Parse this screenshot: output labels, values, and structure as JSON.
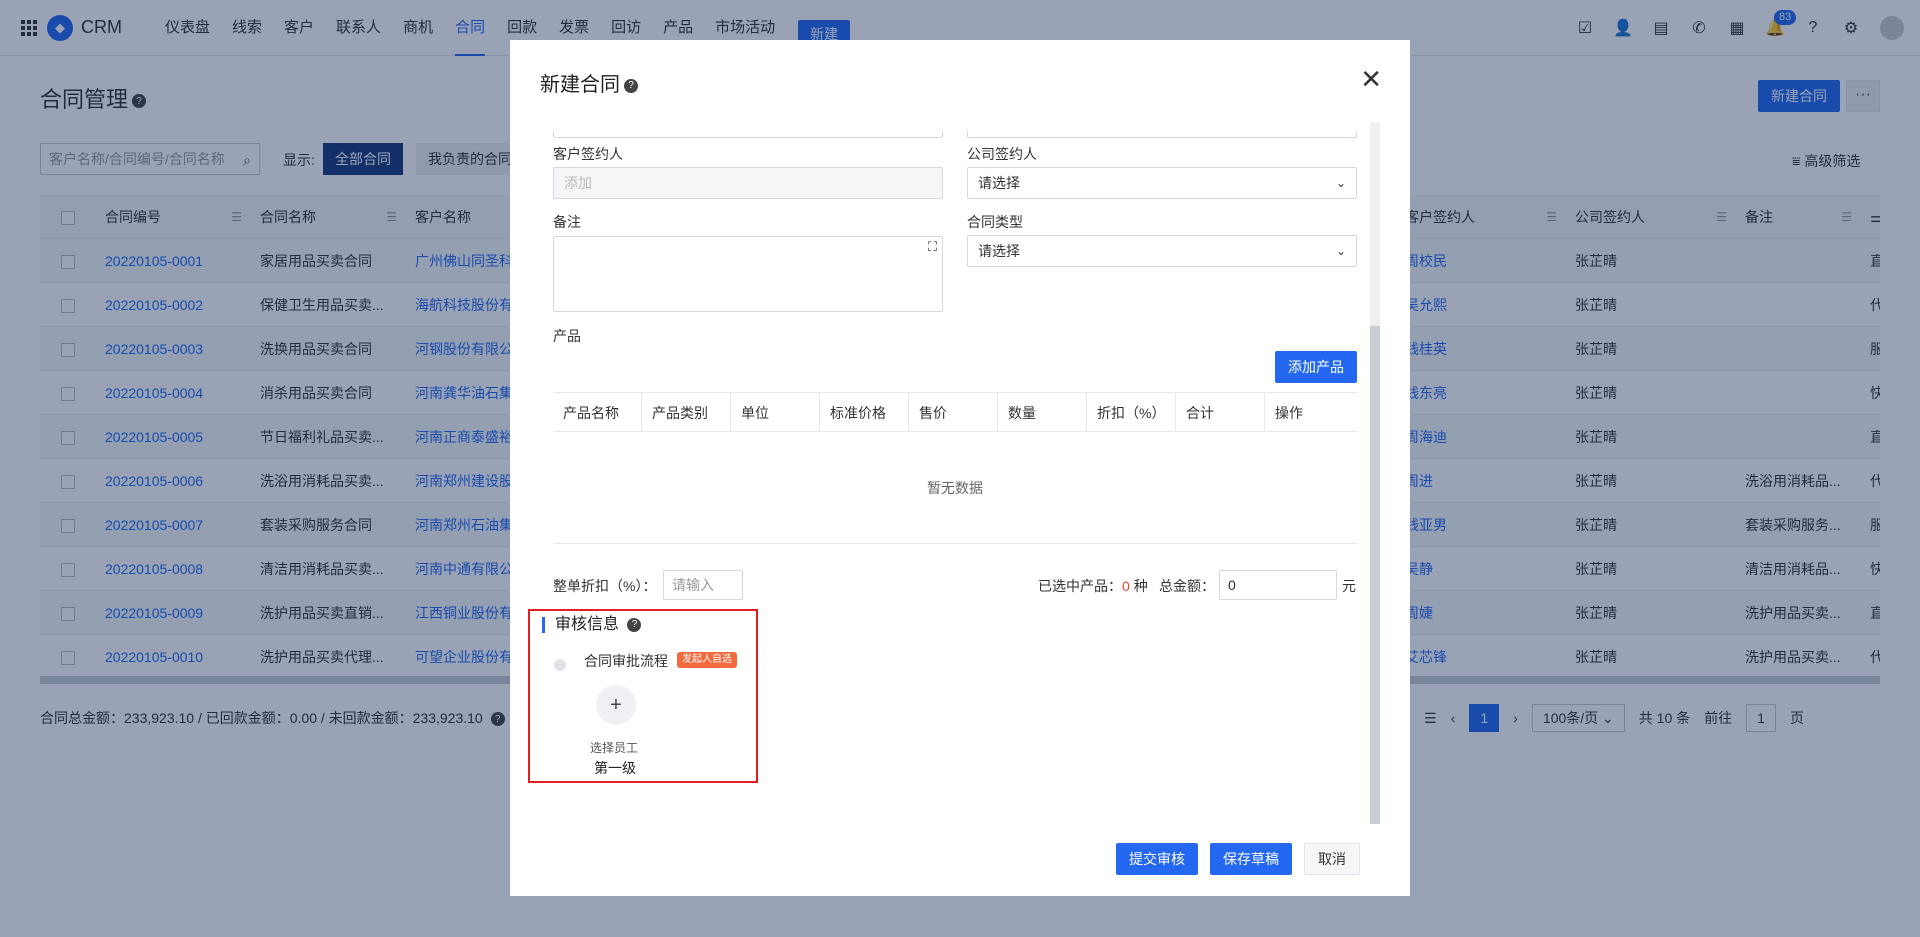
{
  "nav": {
    "brand": "CRM",
    "items": [
      "仪表盘",
      "线索",
      "客户",
      "联系人",
      "商机",
      "合同",
      "回款",
      "发票",
      "回访",
      "产品",
      "市场活动"
    ],
    "active_index": 5,
    "new_label": "新建",
    "notification_count": "83",
    "icons": [
      "task-icon",
      "contact-icon",
      "note-icon",
      "phone-icon",
      "calendar-icon",
      "bell-icon",
      "help-icon",
      "settings-icon"
    ]
  },
  "page": {
    "title": "合同管理",
    "new_button": "新建合同",
    "more_button": "···",
    "search_placeholder": "客户名称/合同编号/合同名称",
    "show_label": "显示:",
    "filter_all": "全部合同",
    "filter_mine": "我负责的合同",
    "advanced_filter": "高级筛选"
  },
  "table": {
    "headers": [
      "合同编号",
      "合同名称",
      "客户名称",
      "客户签约人",
      "公司签约人",
      "备注"
    ],
    "rows": [
      {
        "no": "20220105-0001",
        "name": "家居用品买卖合同",
        "customer": "广州佛山同圣科",
        "signer": "周校民",
        "company_signer": "张芷晴",
        "remark": "",
        "extra": "直"
      },
      {
        "no": "20220105-0002",
        "name": "保健卫生用品买卖...",
        "customer": "海航科技股份有",
        "signer": "吴允熙",
        "company_signer": "张芷晴",
        "remark": "",
        "extra": "代"
      },
      {
        "no": "20220105-0003",
        "name": "洗换用品买卖合同",
        "customer": "河钢股份有限公",
        "signer": "钱桂英",
        "company_signer": "张芷晴",
        "remark": "",
        "extra": "服"
      },
      {
        "no": "20220105-0004",
        "name": "消杀用品买卖合同",
        "customer": "河南龚华油石集",
        "signer": "钱东亮",
        "company_signer": "张芷晴",
        "remark": "",
        "extra": "快"
      },
      {
        "no": "20220105-0005",
        "name": "节日福利礼品买卖...",
        "customer": "河南正商泰盛裕",
        "signer": "周海迪",
        "company_signer": "张芷晴",
        "remark": "",
        "extra": "直"
      },
      {
        "no": "20220105-0006",
        "name": "洗浴用消耗品买卖...",
        "customer": "河南郑州建设股",
        "signer": "周进",
        "company_signer": "张芷晴",
        "remark": "洗浴用消耗品...",
        "extra": "代"
      },
      {
        "no": "20220105-0007",
        "name": "套装采购服务合同",
        "customer": "河南郑州石油集",
        "signer": "钱亚男",
        "company_signer": "张芷晴",
        "remark": "套装采购服务...",
        "extra": "服"
      },
      {
        "no": "20220105-0008",
        "name": "清洁用消耗品买卖...",
        "customer": "河南中通有限公",
        "signer": "吴静",
        "company_signer": "张芷晴",
        "remark": "清洁用消耗品...",
        "extra": "快"
      },
      {
        "no": "20220105-0009",
        "name": "洗护用品买卖直销...",
        "customer": "江西铜业股份有",
        "signer": "周婕",
        "company_signer": "张芷晴",
        "remark": "洗护用品买卖...",
        "extra": "直"
      },
      {
        "no": "20220105-0010",
        "name": "洗护用品买卖代理...",
        "customer": "可望企业股份有",
        "signer": "艾芯锋",
        "company_signer": "张芷晴",
        "remark": "洗护用品买卖...",
        "extra": "代"
      }
    ],
    "footer_summary": "合同总金额：233,923.10 / 已回款金额：0.00 / 未回款金额：233,923.10",
    "pager": {
      "current": "1",
      "page_size": "100条/页",
      "total": "共 10 条",
      "goto_label": "前往",
      "goto_value": "1",
      "page_unit": "页"
    }
  },
  "modal": {
    "title": "新建合同",
    "customer_signer_label": "客户签约人",
    "customer_signer_placeholder": "添加",
    "company_signer_label": "公司签约人",
    "company_signer_placeholder": "请选择",
    "remark_label": "备注",
    "contract_type_label": "合同类型",
    "contract_type_placeholder": "请选择",
    "product_label": "产品",
    "add_product": "添加产品",
    "product_headers": [
      "产品名称",
      "产品类别",
      "单位",
      "标准价格",
      "售价",
      "数量",
      "折扣（%）",
      "合计",
      "操作"
    ],
    "empty_text": "暂无数据",
    "discount_label": "整单折扣（%）：",
    "discount_placeholder": "请输入",
    "selected_label": "已选中产品：",
    "selected_count": "0",
    "selected_unit": "种",
    "total_label": "总金额：",
    "total_value": "0",
    "currency": "元",
    "audit": {
      "title": "审核信息",
      "flow_name": "合同审批流程",
      "flow_tag": "发起人自选",
      "choose_employee": "选择员工",
      "level": "第一级"
    },
    "submit": "提交审核",
    "save_draft": "保存草稿",
    "cancel": "取消"
  },
  "colors": {
    "primary": "#2468f2",
    "dark_button": "#1a3a7a",
    "highlight_box": "#e02020",
    "tag": "#f56a3d"
  }
}
